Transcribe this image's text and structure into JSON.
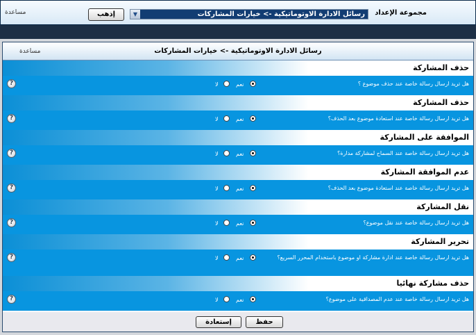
{
  "top": {
    "label": "مجموعة الإعداد",
    "select_value": "رسائل الادارة الاوتوماتيكية -> خيارات المشاركات",
    "go_button": "إذهب",
    "help": "مساعدة"
  },
  "panel": {
    "title": "رسائل الادارة الاوتوماتيكية -> خيارات المشاركات",
    "help": "مساعدة"
  },
  "option_yes": "نعم",
  "option_no": "لا",
  "sections": [
    {
      "title": "حذف المشاركة",
      "question": "هل تريد ارسال رسالة خاصة عند حذف موضوع ؟",
      "selected": "yes"
    },
    {
      "title": "حذف المشاركة",
      "question": "هل تريد ارسال رسالة خاصة عند استعادة موضوع بعد الحذف؟",
      "selected": "yes"
    },
    {
      "title": "الموافقة على المشاركة",
      "question": "هل تريد ارسال رسالة خاصة عند السماح لمشاركة مدارة؟",
      "selected": "yes"
    },
    {
      "title": "عدم الموافقة المشاركة",
      "question": "هل تريد ارسال رسالة خاصة عند استعادة موضوع بعد الحذف؟",
      "selected": "yes"
    },
    {
      "title": "نقل المشاركة",
      "question": "هل تريد ارسال رسالة خاصة عند نقل موضوع؟",
      "selected": "yes"
    },
    {
      "title": "تحرير المشاركة",
      "question": "هل تريد ارسال رسالة خاصة عند ادارة مشاركة او موضوع باستخدام المحرر السريع؟",
      "selected": "yes"
    },
    {
      "title": "حذف مشاركة نهائيا",
      "question": "هل تريد ارسال رسالة خاصة عند عدم المصداقية على موضوع؟",
      "selected": "yes"
    }
  ],
  "footer": {
    "save": "حفظ",
    "restore": "إستعادة"
  }
}
